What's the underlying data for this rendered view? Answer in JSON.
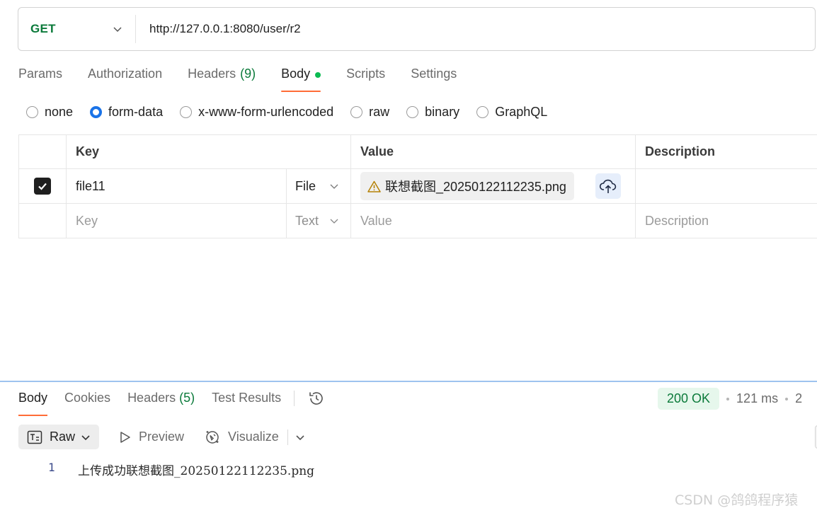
{
  "request": {
    "method": "GET",
    "url": "http://127.0.0.1:8080/user/r2"
  },
  "request_tabs": [
    {
      "label": "Params",
      "count": ""
    },
    {
      "label": "Authorization",
      "count": ""
    },
    {
      "label": "Headers",
      "count": "(9)"
    },
    {
      "label": "Body",
      "count": ""
    },
    {
      "label": "Scripts",
      "count": ""
    },
    {
      "label": "Settings",
      "count": ""
    }
  ],
  "active_request_tab": "Body",
  "body_types": [
    "none",
    "form-data",
    "x-www-form-urlencoded",
    "raw",
    "binary",
    "GraphQL"
  ],
  "selected_body_type": "form-data",
  "params_table": {
    "headers": {
      "key": "Key",
      "value": "Value",
      "description": "Description"
    },
    "rows": [
      {
        "checked": true,
        "key": "file11",
        "type": "File",
        "value": "联想截图_20250122112235.png",
        "description": ""
      }
    ],
    "new_row": {
      "key_placeholder": "Key",
      "type": "Text",
      "value_placeholder": "Value",
      "description_placeholder": "Description"
    }
  },
  "response_tabs": [
    {
      "label": "Body",
      "count": ""
    },
    {
      "label": "Cookies",
      "count": ""
    },
    {
      "label": "Headers",
      "count": "(5)"
    },
    {
      "label": "Test Results",
      "count": ""
    }
  ],
  "active_response_tab": "Body",
  "response_status": "200 OK",
  "response_time": "121 ms",
  "response_size_partial": "2",
  "view_modes": {
    "raw": "Raw",
    "preview": "Preview",
    "visualize": "Visualize"
  },
  "response_body": {
    "line_number": "1",
    "text": "上传成功联想截图_20250122112235.png"
  },
  "watermark": "CSDN @鸽鸽程序猿",
  "colors": {
    "accent": "#ff6c37",
    "success": "#0b7a3a",
    "radio": "#1a73e8"
  },
  "icons": [
    "chevron-down-icon",
    "checkbox-checked-icon",
    "warning-icon",
    "cloud-upload-icon",
    "history-icon",
    "raw-text-icon",
    "play-icon",
    "visualize-icon"
  ]
}
